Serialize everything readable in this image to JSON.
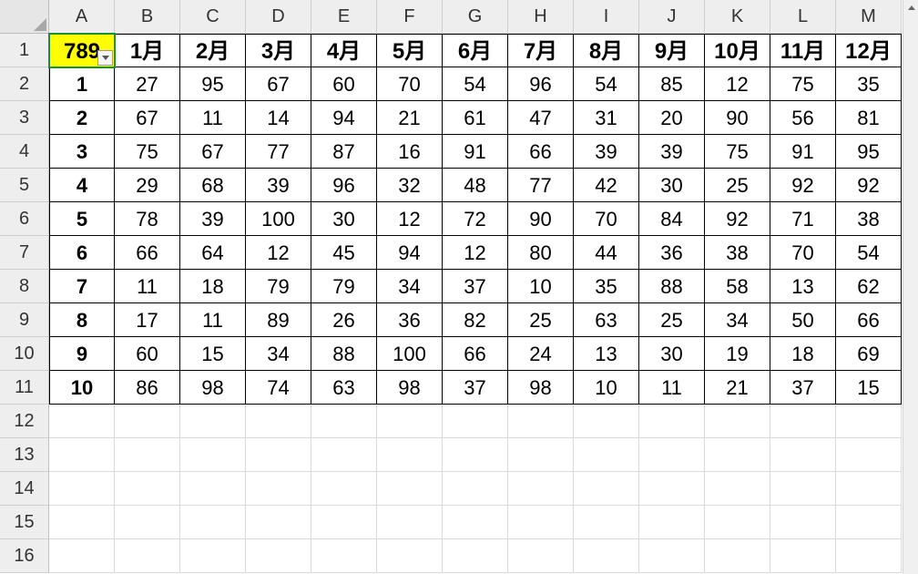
{
  "columnLetters": [
    "A",
    "B",
    "C",
    "D",
    "E",
    "F",
    "G",
    "H",
    "I",
    "J",
    "K",
    "L",
    "M"
  ],
  "rowNumbers": [
    "1",
    "2",
    "3",
    "4",
    "5",
    "6",
    "7",
    "8",
    "9",
    "10",
    "11",
    "12",
    "13",
    "14",
    "15",
    "16"
  ],
  "cornerValue": "789",
  "monthHeaders": [
    "1月",
    "2月",
    "3月",
    "4月",
    "5月",
    "6月",
    "7月",
    "8月",
    "9月",
    "10月",
    "11月",
    "12月"
  ],
  "rowLabels": [
    "1",
    "2",
    "3",
    "4",
    "5",
    "6",
    "7",
    "8",
    "9",
    "10"
  ],
  "data": [
    [
      27,
      95,
      67,
      60,
      70,
      54,
      96,
      54,
      85,
      12,
      75,
      35
    ],
    [
      67,
      11,
      14,
      94,
      21,
      61,
      47,
      31,
      20,
      90,
      56,
      81
    ],
    [
      75,
      67,
      77,
      87,
      16,
      91,
      66,
      39,
      39,
      75,
      91,
      95
    ],
    [
      29,
      68,
      39,
      96,
      32,
      48,
      77,
      42,
      30,
      25,
      92,
      92
    ],
    [
      78,
      39,
      100,
      30,
      12,
      72,
      90,
      70,
      84,
      92,
      71,
      38
    ],
    [
      66,
      64,
      12,
      45,
      94,
      12,
      80,
      44,
      36,
      38,
      70,
      54
    ],
    [
      11,
      18,
      79,
      79,
      34,
      37,
      10,
      35,
      88,
      58,
      13,
      62
    ],
    [
      17,
      11,
      89,
      26,
      36,
      82,
      25,
      63,
      25,
      34,
      50,
      66
    ],
    [
      60,
      15,
      34,
      88,
      100,
      66,
      24,
      13,
      30,
      19,
      18,
      69
    ],
    [
      86,
      98,
      74,
      63,
      98,
      37,
      98,
      10,
      11,
      21,
      37,
      15
    ]
  ],
  "selectedCell": "A1",
  "colors": {
    "highlight": "#ffff00",
    "selectionBorder": "#1a8f3a"
  }
}
